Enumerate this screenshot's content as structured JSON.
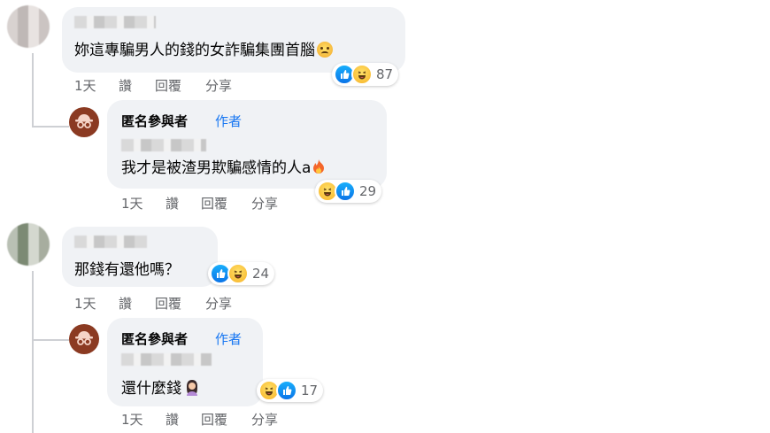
{
  "colors": {
    "bubble_bg": "#f0f2f5",
    "author_badge": "#1877f2",
    "secondary_text": "#65676b",
    "like_blue": "#1877f2",
    "anon_avatar": "#8b3a22"
  },
  "comments": [
    {
      "text": "妳這專騙男人的錢的女詐騙集團首腦",
      "emoji": "cold-sweat-face",
      "reactions": {
        "icons": [
          "like-icon",
          "haha-icon"
        ],
        "count": "87"
      },
      "actions": {
        "time": "1天",
        "like": "讚",
        "reply": "回覆",
        "share": "分享"
      },
      "reply": {
        "author": "匿名參與者",
        "badge": "作者",
        "text": "我才是被渣男欺騙感情的人a",
        "emoji": "fire",
        "reactions": {
          "icons": [
            "haha-icon",
            "like-icon"
          ],
          "count": "29"
        },
        "actions": {
          "time": "1天",
          "like": "讚",
          "reply": "回覆",
          "share": "分享"
        }
      }
    },
    {
      "text": "那錢有還他嗎？",
      "reactions": {
        "icons": [
          "like-icon",
          "haha-icon"
        ],
        "count": "24"
      },
      "actions": {
        "time": "1天",
        "like": "讚",
        "reply": "回覆",
        "share": "分享"
      },
      "reply": {
        "author": "匿名參與者",
        "badge": "作者",
        "text": "還什麼錢",
        "emoji": "woman-raising-hand",
        "reactions": {
          "icons": [
            "haha-icon",
            "like-icon"
          ],
          "count": "17"
        },
        "actions": {
          "time": "1天",
          "like": "讚",
          "reply": "回覆",
          "share": "分享"
        }
      }
    }
  ]
}
